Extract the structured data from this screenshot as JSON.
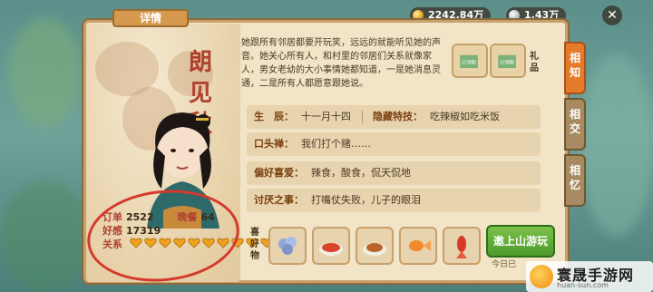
{
  "currency": {
    "gold": "2242.84万",
    "silver": "1.43万"
  },
  "panel": {
    "title": "详情"
  },
  "character": {
    "name_chars": [
      "朗",
      "见",
      "秋"
    ],
    "description": "她跟所有邻居都要开玩笑，远远的就能听见她的声音。她关心所有人，和村里的邻居们关系就像家人，男女老幼的大小事情她都知道，一是她消息灵通，二是所有人都愿意跟她说。"
  },
  "stats": {
    "orders_label": "订单",
    "orders_value": "2522",
    "dinner_label": "晚餐",
    "dinner_value": "64",
    "favor_label": "好感",
    "favor_value": "17319",
    "relation_label": "关系",
    "relation_hearts": 10
  },
  "gifts": {
    "label": "礼品",
    "items": [
      {
        "name": "已领取",
        "icon": "gift-box-icon"
      },
      {
        "name": "已领取",
        "icon": "gift-box-icon"
      }
    ]
  },
  "info_rows": {
    "birthday_key": "生　辰：",
    "birthday_value": "十一月十四",
    "hidden_trait_key": "隐藏特技：",
    "hidden_trait_value": "吃辣椒如吃米饭",
    "catchphrase_key": "口头禅：",
    "catchphrase_value": "我们打个赌……",
    "hobby_key": "偏好喜爱：",
    "hobby_value": "辣食，酸食，侃天侃地",
    "dislike_key": "讨厌之事：",
    "dislike_value": "打嘴仗失败，儿子的眼泪"
  },
  "side_tabs": [
    {
      "label": "相知",
      "active": true
    },
    {
      "label": "相交",
      "active": false
    },
    {
      "label": "相忆",
      "active": false
    }
  ],
  "favorites": {
    "label": "喜好物",
    "items": [
      {
        "icon": "blue-flower-icon"
      },
      {
        "icon": "spicy-dish-icon"
      },
      {
        "icon": "meat-dish-icon"
      },
      {
        "icon": "goldfish-icon"
      },
      {
        "icon": "red-fish-icon"
      }
    ]
  },
  "action": {
    "button_label": "邀上山游玩",
    "today_text": "今日已"
  },
  "watermark": {
    "title": "寰晟手游网",
    "url": "huan-sun.com"
  },
  "colors": {
    "panel_bg": "#f2e4c6",
    "accent_red": "#b0412e",
    "tab_active": "#e37b2b",
    "button_green": "#4e9a2c",
    "circle_red": "#d43a2c"
  }
}
